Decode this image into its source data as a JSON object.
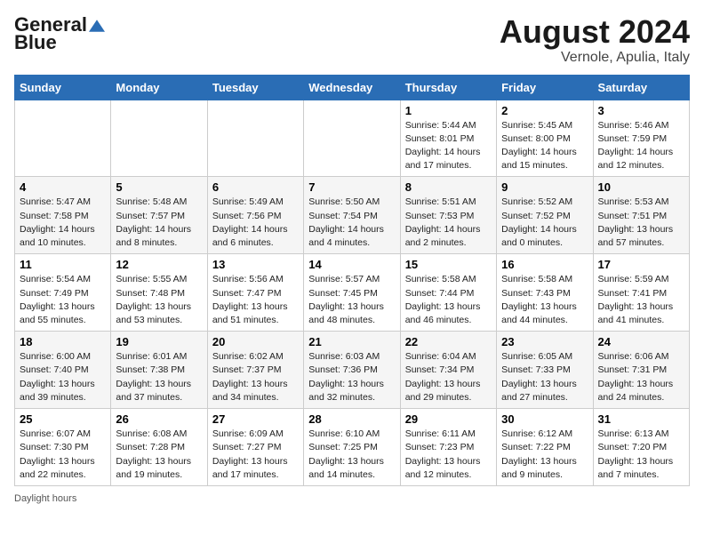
{
  "header": {
    "logo_general": "General",
    "logo_blue": "Blue",
    "month_title": "August 2024",
    "location": "Vernole, Apulia, Italy"
  },
  "days_of_week": [
    "Sunday",
    "Monday",
    "Tuesday",
    "Wednesday",
    "Thursday",
    "Friday",
    "Saturday"
  ],
  "weeks": [
    [
      {
        "day": "",
        "info": ""
      },
      {
        "day": "",
        "info": ""
      },
      {
        "day": "",
        "info": ""
      },
      {
        "day": "",
        "info": ""
      },
      {
        "day": "1",
        "info": "Sunrise: 5:44 AM\nSunset: 8:01 PM\nDaylight: 14 hours and 17 minutes."
      },
      {
        "day": "2",
        "info": "Sunrise: 5:45 AM\nSunset: 8:00 PM\nDaylight: 14 hours and 15 minutes."
      },
      {
        "day": "3",
        "info": "Sunrise: 5:46 AM\nSunset: 7:59 PM\nDaylight: 14 hours and 12 minutes."
      }
    ],
    [
      {
        "day": "4",
        "info": "Sunrise: 5:47 AM\nSunset: 7:58 PM\nDaylight: 14 hours and 10 minutes."
      },
      {
        "day": "5",
        "info": "Sunrise: 5:48 AM\nSunset: 7:57 PM\nDaylight: 14 hours and 8 minutes."
      },
      {
        "day": "6",
        "info": "Sunrise: 5:49 AM\nSunset: 7:56 PM\nDaylight: 14 hours and 6 minutes."
      },
      {
        "day": "7",
        "info": "Sunrise: 5:50 AM\nSunset: 7:54 PM\nDaylight: 14 hours and 4 minutes."
      },
      {
        "day": "8",
        "info": "Sunrise: 5:51 AM\nSunset: 7:53 PM\nDaylight: 14 hours and 2 minutes."
      },
      {
        "day": "9",
        "info": "Sunrise: 5:52 AM\nSunset: 7:52 PM\nDaylight: 14 hours and 0 minutes."
      },
      {
        "day": "10",
        "info": "Sunrise: 5:53 AM\nSunset: 7:51 PM\nDaylight: 13 hours and 57 minutes."
      }
    ],
    [
      {
        "day": "11",
        "info": "Sunrise: 5:54 AM\nSunset: 7:49 PM\nDaylight: 13 hours and 55 minutes."
      },
      {
        "day": "12",
        "info": "Sunrise: 5:55 AM\nSunset: 7:48 PM\nDaylight: 13 hours and 53 minutes."
      },
      {
        "day": "13",
        "info": "Sunrise: 5:56 AM\nSunset: 7:47 PM\nDaylight: 13 hours and 51 minutes."
      },
      {
        "day": "14",
        "info": "Sunrise: 5:57 AM\nSunset: 7:45 PM\nDaylight: 13 hours and 48 minutes."
      },
      {
        "day": "15",
        "info": "Sunrise: 5:58 AM\nSunset: 7:44 PM\nDaylight: 13 hours and 46 minutes."
      },
      {
        "day": "16",
        "info": "Sunrise: 5:58 AM\nSunset: 7:43 PM\nDaylight: 13 hours and 44 minutes."
      },
      {
        "day": "17",
        "info": "Sunrise: 5:59 AM\nSunset: 7:41 PM\nDaylight: 13 hours and 41 minutes."
      }
    ],
    [
      {
        "day": "18",
        "info": "Sunrise: 6:00 AM\nSunset: 7:40 PM\nDaylight: 13 hours and 39 minutes."
      },
      {
        "day": "19",
        "info": "Sunrise: 6:01 AM\nSunset: 7:38 PM\nDaylight: 13 hours and 37 minutes."
      },
      {
        "day": "20",
        "info": "Sunrise: 6:02 AM\nSunset: 7:37 PM\nDaylight: 13 hours and 34 minutes."
      },
      {
        "day": "21",
        "info": "Sunrise: 6:03 AM\nSunset: 7:36 PM\nDaylight: 13 hours and 32 minutes."
      },
      {
        "day": "22",
        "info": "Sunrise: 6:04 AM\nSunset: 7:34 PM\nDaylight: 13 hours and 29 minutes."
      },
      {
        "day": "23",
        "info": "Sunrise: 6:05 AM\nSunset: 7:33 PM\nDaylight: 13 hours and 27 minutes."
      },
      {
        "day": "24",
        "info": "Sunrise: 6:06 AM\nSunset: 7:31 PM\nDaylight: 13 hours and 24 minutes."
      }
    ],
    [
      {
        "day": "25",
        "info": "Sunrise: 6:07 AM\nSunset: 7:30 PM\nDaylight: 13 hours and 22 minutes."
      },
      {
        "day": "26",
        "info": "Sunrise: 6:08 AM\nSunset: 7:28 PM\nDaylight: 13 hours and 19 minutes."
      },
      {
        "day": "27",
        "info": "Sunrise: 6:09 AM\nSunset: 7:27 PM\nDaylight: 13 hours and 17 minutes."
      },
      {
        "day": "28",
        "info": "Sunrise: 6:10 AM\nSunset: 7:25 PM\nDaylight: 13 hours and 14 minutes."
      },
      {
        "day": "29",
        "info": "Sunrise: 6:11 AM\nSunset: 7:23 PM\nDaylight: 13 hours and 12 minutes."
      },
      {
        "day": "30",
        "info": "Sunrise: 6:12 AM\nSunset: 7:22 PM\nDaylight: 13 hours and 9 minutes."
      },
      {
        "day": "31",
        "info": "Sunrise: 6:13 AM\nSunset: 7:20 PM\nDaylight: 13 hours and 7 minutes."
      }
    ]
  ],
  "footer": {
    "daylight_hours": "Daylight hours"
  }
}
